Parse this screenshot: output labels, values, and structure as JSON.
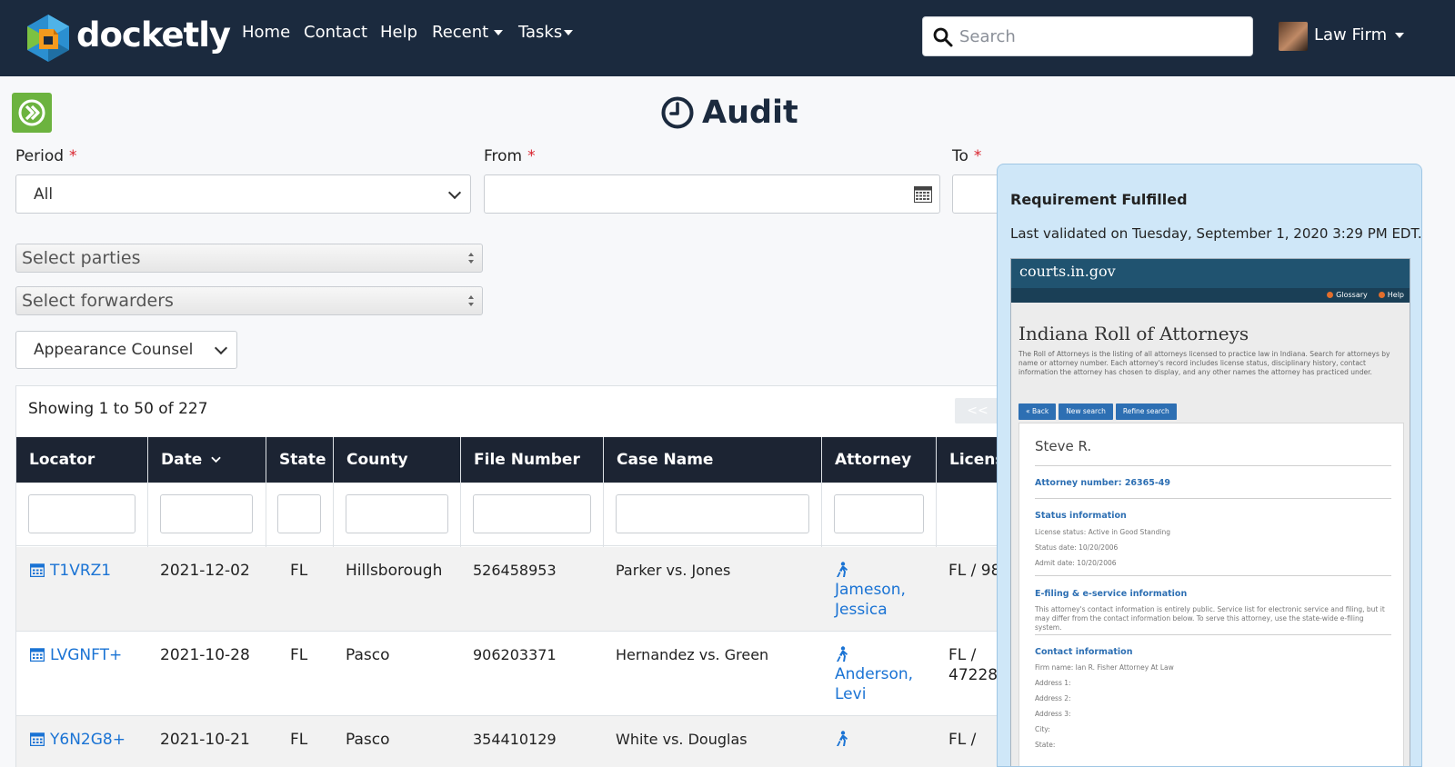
{
  "nav": {
    "brand": "docketly",
    "links": [
      "Home",
      "Contact",
      "Help",
      "Recent",
      "Tasks"
    ],
    "search_placeholder": "Search",
    "user_name": "Law Firm"
  },
  "page": {
    "title": "Audit"
  },
  "form": {
    "period_label": "Period",
    "period_value": "All",
    "from_label": "From",
    "to_label": "To",
    "required_mark": "*",
    "parties_placeholder": "Select parties",
    "forwarders_placeholder": "Select forwarders",
    "role_value": "Appearance Counsel"
  },
  "table": {
    "showing": "Showing 1 to 50 of 227",
    "pager_prev": "<<",
    "columns": [
      "Locator",
      "Date",
      "State",
      "County",
      "File Number",
      "Case Name",
      "Attorney",
      "License"
    ],
    "rows": [
      {
        "locator": "T1VRZ1",
        "date": "2021-12-02",
        "state": "FL",
        "county": "Hillsborough",
        "file": "526458953",
        "case": "Parker vs. Jones",
        "attorney": "Jameson, Jessica",
        "license": "FL / 98"
      },
      {
        "locator": "LVGNFT+",
        "date": "2021-10-28",
        "state": "FL",
        "county": "Pasco",
        "file": "906203371",
        "case": "Hernandez vs. Green",
        "attorney": "Anderson, Levi",
        "license": "FL / 47228"
      },
      {
        "locator": "Y6N2G8+",
        "date": "2021-10-21",
        "state": "FL",
        "county": "Pasco",
        "file": "354410129",
        "case": "White vs. Douglas",
        "attorney": "",
        "license": "FL /"
      }
    ]
  },
  "popover": {
    "title": "Requirement Fulfilled",
    "subtitle": "Last validated on Tuesday, September 1, 2020 3:29 PM EDT.",
    "screenshot": {
      "site": "courts.in.gov",
      "top_links": [
        "Glossary",
        "Help"
      ],
      "heading": "Indiana Roll of Attorneys",
      "intro": "The Roll of Attorneys is the listing of all attorneys licensed to practice law in Indiana. Search for attorneys by name or attorney number. Each attorney's record includes license status, disciplinary history, contact information the attorney has chosen to display, and any other names the attorney has practiced under.",
      "buttons": [
        "« Back",
        "New search",
        "Refine search"
      ],
      "attorney_name": "Steve R.",
      "attorney_number": "Attorney number: 26365-49",
      "status_heading": "Status information",
      "status_lines": [
        "License status: Active in Good Standing",
        "Status date: 10/20/2006",
        "Admit date: 10/20/2006"
      ],
      "efiling_heading": "E-filing & e-service information",
      "efiling_text": "This attorney's contact information is entirely public. Service list for electronic service and filing, but it may differ from the contact information below. To serve this attorney, use the state-wide e-filing system.",
      "contact_heading": "Contact information",
      "contact_lines": [
        "Firm name: Ian R. Fisher Attorney At Law",
        "Address 1:",
        "Address 2:",
        "Address 3:",
        "City:",
        "State:"
      ]
    }
  },
  "colors": {
    "navbar": "#1b2a3e",
    "accent_green": "#6cb33f",
    "link": "#1a73d4",
    "table_header": "#1c2433",
    "popover_bg": "#cfe7f8"
  }
}
